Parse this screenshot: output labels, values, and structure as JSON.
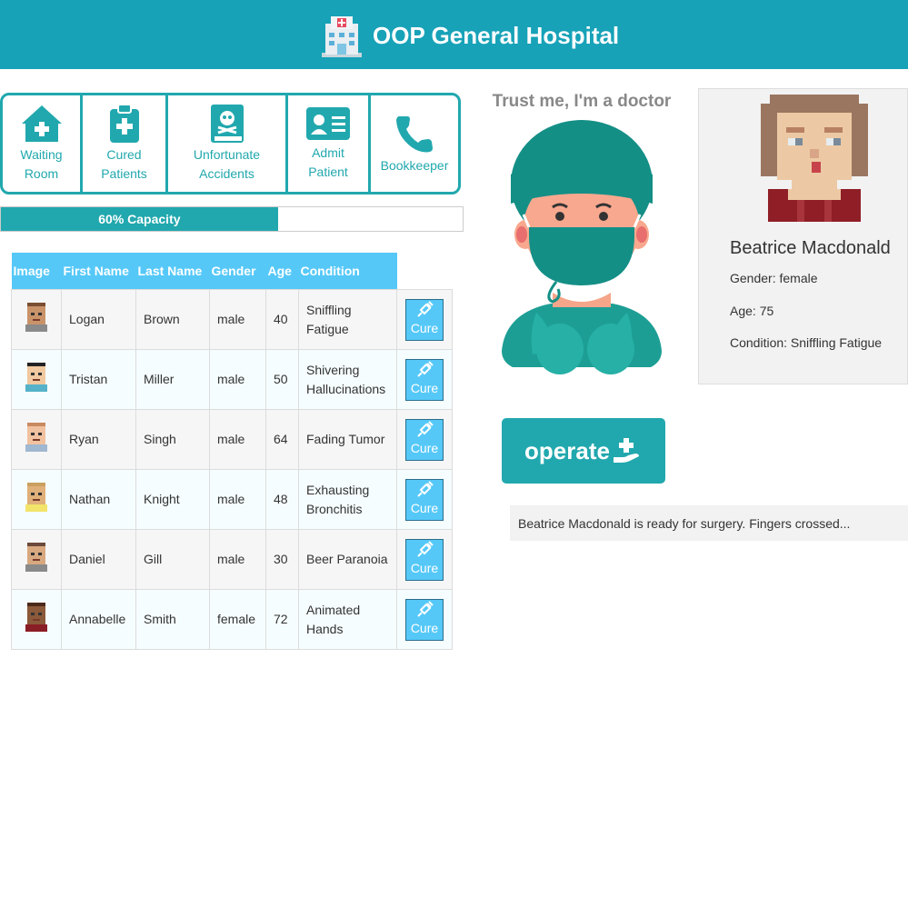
{
  "header": {
    "title": "OOP General Hospital"
  },
  "nav": [
    {
      "label": "Waiting\nRoom",
      "icon": "house-medical-icon"
    },
    {
      "label": "Cured\nPatients",
      "icon": "clipboard-medical-icon"
    },
    {
      "label": "Unfortunate\nAccidents",
      "icon": "skull-book-icon"
    },
    {
      "label": "Admit\nPatient",
      "icon": "id-card-icon"
    },
    {
      "label": "Bookkeeper",
      "icon": "phone-icon"
    }
  ],
  "capacity": {
    "label": "60% Capacity",
    "fraction": 0.6
  },
  "table": {
    "headers": [
      "Image",
      "First Name",
      "Last Name",
      "Gender",
      "Age",
      "Condition"
    ],
    "cure_label": "Cure",
    "rows": [
      {
        "first": "Logan",
        "last": "Brown",
        "gender": "male",
        "age": "40",
        "condition": "Sniffling Fatigue"
      },
      {
        "first": "Tristan",
        "last": "Miller",
        "gender": "male",
        "age": "50",
        "condition": "Shivering Hallucinations"
      },
      {
        "first": "Ryan",
        "last": "Singh",
        "gender": "male",
        "age": "64",
        "condition": "Fading Tumor"
      },
      {
        "first": "Nathan",
        "last": "Knight",
        "gender": "male",
        "age": "48",
        "condition": "Exhausting Bronchitis"
      },
      {
        "first": "Daniel",
        "last": "Gill",
        "gender": "male",
        "age": "30",
        "condition": "Beer Paranoia"
      },
      {
        "first": "Annabelle",
        "last": "Smith",
        "gender": "female",
        "age": "72",
        "condition": "Animated Hands"
      }
    ]
  },
  "doctor": {
    "title": "Trust me, I'm a doctor"
  },
  "patient": {
    "name": "Beatrice Macdonald",
    "gender": "Gender: female",
    "age": "Age: 75",
    "condition": "Condition: Sniffling Fatigue"
  },
  "operate": {
    "label": "operate"
  },
  "message": "Beatrice Macdonald is ready for surgery. Fingers crossed...",
  "colors": {
    "teal": "#21a8ae",
    "header": "#17a2b8",
    "table_header": "#55c8f8",
    "cure": "#55c8f8"
  }
}
